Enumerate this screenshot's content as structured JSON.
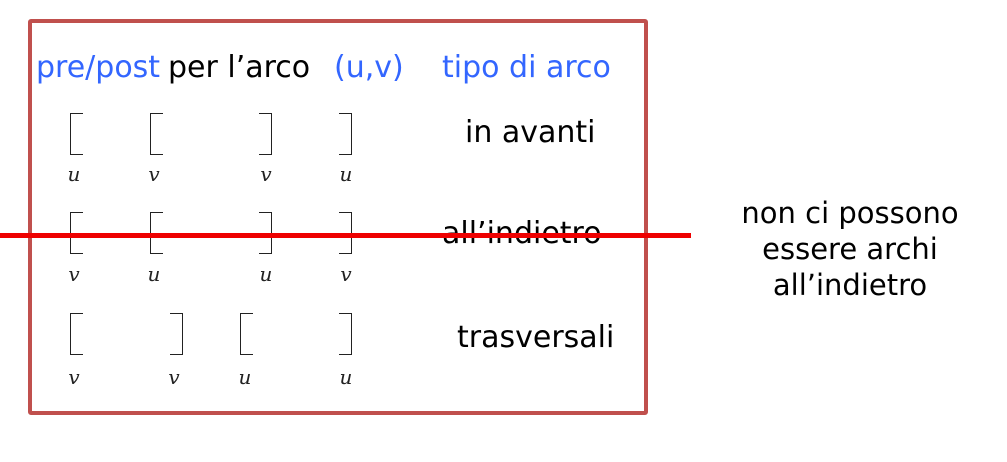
{
  "header": {
    "pre_post": "pre/post",
    "per_arco": " per l’arco ",
    "uv": "(u,v)",
    "tipo": "tipo di arco"
  },
  "rows": [
    {
      "type": "in avanti",
      "brackets": [
        "[",
        "[",
        "]",
        "]"
      ],
      "labels": [
        "u",
        "v",
        "v",
        "u"
      ]
    },
    {
      "type": "all’indietro",
      "brackets": [
        "[",
        "[",
        "]",
        "]"
      ],
      "labels": [
        "v",
        "u",
        "u",
        "v"
      ]
    },
    {
      "type": "trasversali",
      "brackets": [
        "[",
        "]",
        "[",
        "]"
      ],
      "labels": [
        "v",
        "v",
        "u",
        "u"
      ]
    }
  ],
  "note": [
    "non ci possono",
    "essere archi",
    "all’indietro"
  ],
  "colors": {
    "frame": "#c0504d",
    "accent_blue": "#3366ff",
    "strike_red": "#ee0000"
  }
}
